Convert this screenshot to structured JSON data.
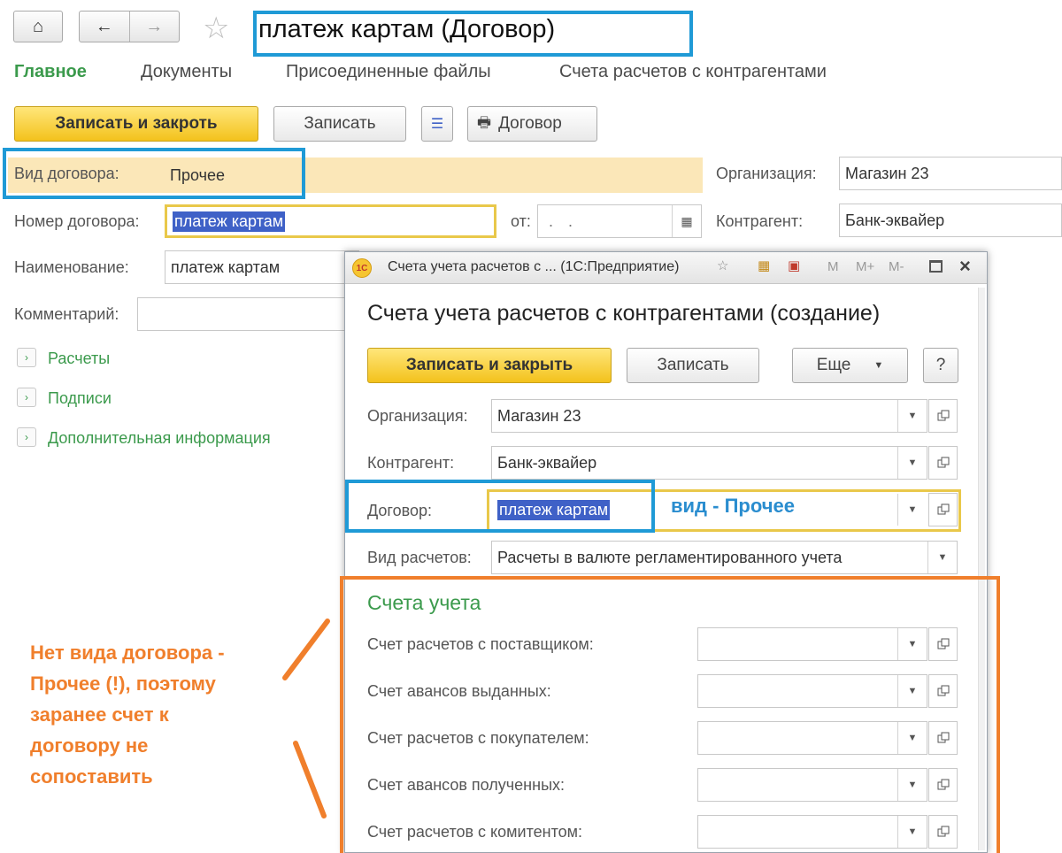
{
  "header": {
    "home_icon": "home-icon",
    "back_icon": "arrow-left-icon",
    "forward_icon": "arrow-right-icon",
    "favorite_icon": "star-icon",
    "title": "платеж картам (Договор)"
  },
  "tabs": [
    {
      "label": "Главное",
      "active": true
    },
    {
      "label": "Документы"
    },
    {
      "label": "Присоединенные файлы"
    },
    {
      "label": "Счета расчетов с контрагентами"
    }
  ],
  "toolbar": {
    "save_close": "Записать и закроть",
    "save": "Записать",
    "print_label": "Договор"
  },
  "form": {
    "contract_type_label": "Вид договора:",
    "contract_type_value": "Прочее",
    "org_label": "Организация:",
    "org_value": "Магазин 23",
    "number_label": "Номер договора:",
    "number_value": "платеж картам",
    "date_label": "от:",
    "date_value": ". .",
    "counterparty_label": "Контрагент:",
    "counterparty_value": "Банк-эквайер",
    "name_label": "Наименование:",
    "name_value": "платеж картам",
    "comment_label": "Комментарий:",
    "comment_value": ""
  },
  "sections": [
    {
      "label": "Расчеты"
    },
    {
      "label": "Подписи"
    },
    {
      "label": "Дополнительная информация"
    }
  ],
  "dialog": {
    "window_title": "Счета учета расчетов с ... (1С:Предприятие)",
    "title_icons": [
      "M",
      "M+",
      "M-"
    ],
    "heading": "Счета учета расчетов с контрагентами (создание)",
    "save_close": "Записать и закрыть",
    "save": "Записать",
    "more": "Еще",
    "help": "?",
    "org_label": "Организация:",
    "org_value": "Магазин 23",
    "counterparty_label": "Контрагент:",
    "counterparty_value": "Банк-эквайер",
    "contract_label": "Договор:",
    "contract_value": "платеж картам",
    "settlement_label": "Вид расчетов:",
    "settlement_value": "Расчеты в валюте регламентированного учета",
    "accounts_heading": "Счета учета",
    "accounts": [
      {
        "label": "Счет расчетов с поставщиком:",
        "value": ""
      },
      {
        "label": "Счет авансов выданных:",
        "value": ""
      },
      {
        "label": "Счет расчетов с покупателем:",
        "value": ""
      },
      {
        "label": "Счет авансов полученных:",
        "value": ""
      },
      {
        "label": "Счет расчетов с комитентом:",
        "value": ""
      }
    ]
  },
  "annotations": {
    "contract_kind": "вид - Прочее",
    "note_lines": [
      "Нет вида договора -",
      "Прочее (!), поэтому",
      "заранее счет к",
      "договору не",
      "сопоставить"
    ]
  },
  "colors": {
    "accent_green": "#3b9a4c",
    "highlight_blue": "#1f9ad6",
    "highlight_orange": "#f07f2c",
    "highlight_yellow": "#e9c84a",
    "selection": "#3f61c7"
  }
}
